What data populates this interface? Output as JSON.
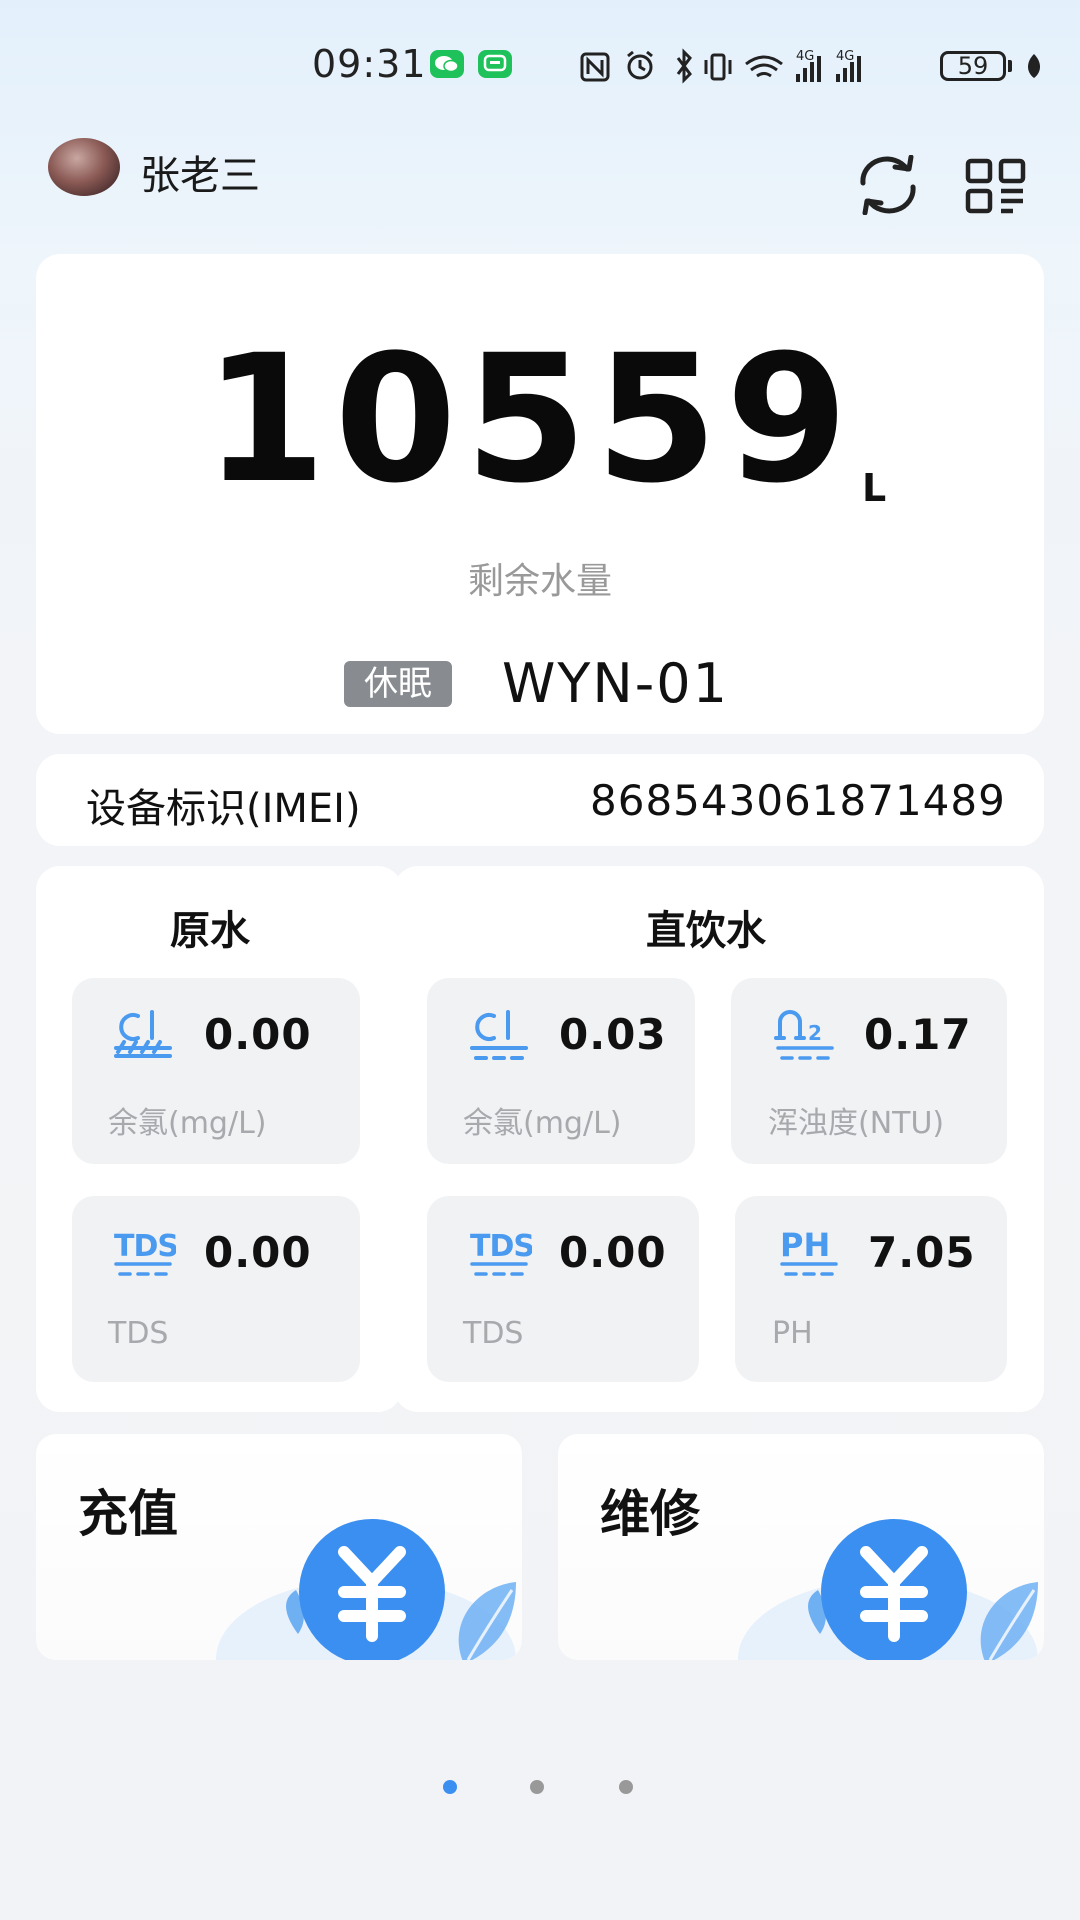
{
  "status_bar": {
    "time": "09:31",
    "battery": "59",
    "icons": [
      "wechat-icon",
      "message-icon",
      "nfc-icon",
      "alarm-icon",
      "bluetooth-icon",
      "vibrate-icon",
      "wifi-icon",
      "signal-4g-icon",
      "signal-4g-icon",
      "battery-icon",
      "leaf-icon"
    ]
  },
  "header": {
    "username": "张老三",
    "refresh_icon": "refresh-icon",
    "qr_icon": "qr-scan-icon"
  },
  "main": {
    "water_value": "10559",
    "water_unit": "L",
    "water_caption": "剩余水量",
    "status_badge": "休眠",
    "device_name": "WYN-01"
  },
  "imei": {
    "label": "设备标识(IMEI)",
    "value": "868543061871489"
  },
  "raw_water": {
    "title": "原水",
    "tiles": [
      {
        "icon": "chlorine-icon",
        "value": "0.00",
        "label": "余氯(mg/L)"
      },
      {
        "icon": "tds-icon",
        "value": "0.00",
        "label": "TDS"
      }
    ]
  },
  "direct_water": {
    "title": "直饮水",
    "tiles": [
      {
        "icon": "chlorine-icon",
        "value": "0.03",
        "label": "余氯(mg/L)"
      },
      {
        "icon": "turbidity-icon",
        "value": "0.17",
        "label": "浑浊度(NTU)"
      },
      {
        "icon": "tds-icon",
        "value": "0.00",
        "label": "TDS"
      },
      {
        "icon": "ph-icon",
        "value": "7.05",
        "label": "PH"
      }
    ]
  },
  "actions": [
    {
      "label": "充值",
      "icon": "yuan-icon"
    },
    {
      "label": "维修",
      "icon": "yuan-icon"
    }
  ],
  "pagination": {
    "total": 3,
    "active": 1
  },
  "colors": {
    "accent": "#3b8ff0",
    "icon_blue": "#4a9af0",
    "badge_gray": "#888b90",
    "tile_bg": "#f1f2f4"
  }
}
